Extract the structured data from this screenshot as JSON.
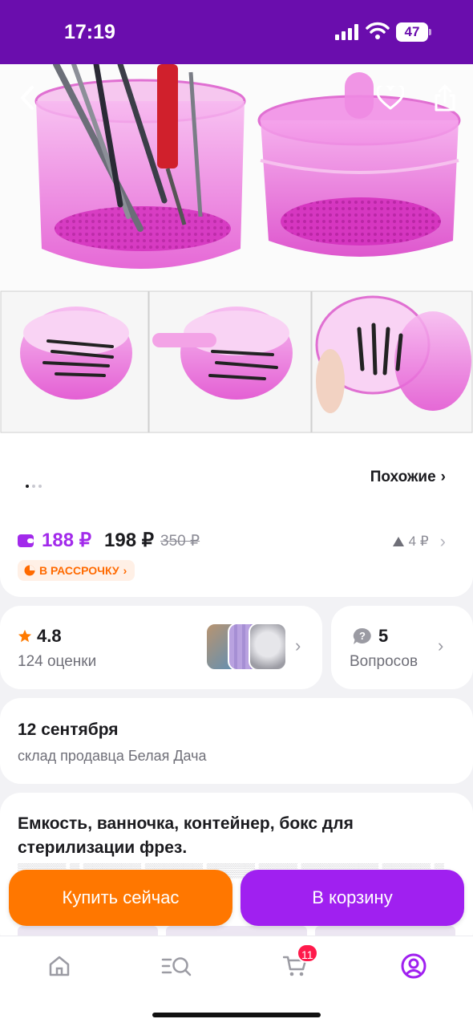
{
  "status_bar": {
    "time": "17:19",
    "battery": "47"
  },
  "gallery": {
    "dots_total": 3,
    "dots_active": 0
  },
  "similar": {
    "label": "Похожие"
  },
  "price": {
    "wallet_price": "188 ₽",
    "price": "198 ₽",
    "old_price": "350 ₽",
    "delta": "4 ₽",
    "installment_label": "В РАССРОЧКУ"
  },
  "rating": {
    "value": "4.8",
    "count": "124 оценки"
  },
  "questions": {
    "count": "5",
    "label": "Вопросов"
  },
  "delivery": {
    "date": "12 сентября",
    "source": "склад продавца Белая Дача"
  },
  "product": {
    "title": "Емкость, ванночка, контейнер, бокс для стерилизации фрез."
  },
  "actions": {
    "buy_now": "Купить сейчас",
    "add_to_cart": "В корзину"
  },
  "tabbar": {
    "cart_badge": "11"
  },
  "colors": {
    "brand": "#6a0dad",
    "accent": "#a020f0",
    "orange": "#ff7700",
    "badge": "#ff1a4b"
  }
}
